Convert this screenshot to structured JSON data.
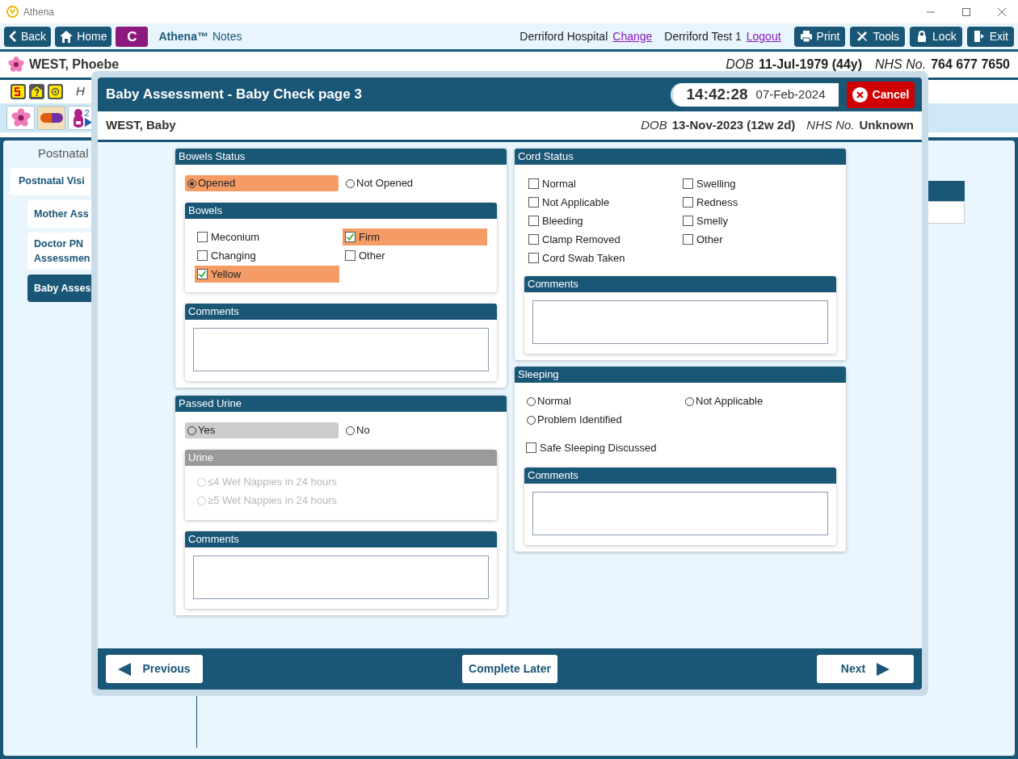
{
  "app": {
    "title": "Athena"
  },
  "toolbar": {
    "nav_buttons": [
      {
        "kind": "back",
        "label": "Back"
      },
      {
        "kind": "home",
        "label": "Home"
      }
    ],
    "c_button": "C",
    "brand": "Athena™",
    "brand_suffix": "Notes",
    "hospital": "Derriford Hospital",
    "change_link": "Change",
    "user": "Derriford Test 1",
    "logout_link": "Logout",
    "actions": [
      {
        "kind": "print",
        "label": "Print"
      },
      {
        "kind": "tools",
        "label": "Tools"
      },
      {
        "kind": "lock",
        "label": "Lock"
      },
      {
        "kind": "exit",
        "label": "Exit"
      }
    ]
  },
  "patient": {
    "name": "WEST, Phoebe",
    "dob_label": "DOB",
    "dob": "11-Jul-1979 (44y)",
    "nhs_label": "NHS No.",
    "nhs": "764 677 7650"
  },
  "alert_row": {
    "text": "H"
  },
  "icon_tabs": [
    {
      "kind": "flower",
      "selected": false
    },
    {
      "kind": "pill",
      "selected": true
    },
    {
      "kind": "person",
      "badge": "2",
      "selected": false
    }
  ],
  "nav": {
    "heading": "Postnatal",
    "items": [
      {
        "label": "Postnatal Visi",
        "selected": false,
        "children": [
          {
            "label": "Mother Ass",
            "selected": false
          },
          {
            "label": "Doctor PN Assessmen",
            "selected": false
          },
          {
            "label": "Baby Asses",
            "selected": true
          }
        ]
      }
    ]
  },
  "dialog": {
    "title": "Baby Assessment - Baby Check page 3",
    "time": "14:42:28",
    "date": "07-Feb-2024",
    "cancel": "Cancel",
    "baby": {
      "name": "WEST, Baby",
      "dob_label": "DOB",
      "dob": "13-Nov-2023 (12w 2d)",
      "nhs_label": "NHS No.",
      "nhs": "Unknown"
    },
    "left": [
      {
        "title": "Bowels Status",
        "radios": [
          {
            "label": "Opened",
            "selected": true,
            "highlighted": true
          },
          {
            "label": "Not Opened",
            "selected": false,
            "highlighted": false
          }
        ],
        "sub": [
          {
            "kind": "checks",
            "title": "Bowels",
            "disabled": false,
            "options": [
              {
                "label": "Meconium",
                "checked": false
              },
              {
                "label": "Firm",
                "checked": true
              },
              {
                "label": "Changing",
                "checked": false
              },
              {
                "label": "Other",
                "checked": false
              },
              {
                "label": "Yellow",
                "checked": true
              }
            ]
          },
          {
            "kind": "comments",
            "title": "Comments"
          }
        ]
      },
      {
        "title": "Passed Urine",
        "radios": [
          {
            "label": "Yes",
            "selected": false,
            "highlighted": true
          },
          {
            "label": "No",
            "selected": false,
            "highlighted": false
          }
        ],
        "sub": [
          {
            "kind": "radios",
            "title": "Urine",
            "disabled": true,
            "options": [
              {
                "label": "≤4 Wet Nappies in 24 hours",
                "selected": false
              },
              {
                "label": "≥5 Wet Nappies in 24 hours",
                "selected": false
              }
            ]
          },
          {
            "kind": "comments",
            "title": "Comments"
          }
        ]
      }
    ],
    "right": [
      {
        "title": "Cord Status",
        "columns": [
          [
            {
              "label": "Normal",
              "checked": false
            },
            {
              "label": "Not Applicable",
              "checked": false
            },
            {
              "label": "Bleeding",
              "checked": false
            },
            {
              "label": "Clamp Removed",
              "checked": false
            },
            {
              "label": "Cord Swab Taken",
              "checked": false
            }
          ],
          [
            {
              "label": "Swelling",
              "checked": false
            },
            {
              "label": "Redness",
              "checked": false
            },
            {
              "label": "Smelly",
              "checked": false
            },
            {
              "label": "Other",
              "checked": false
            }
          ]
        ],
        "sub": [
          {
            "kind": "comments",
            "title": "Comments"
          }
        ]
      },
      {
        "title": "Sleeping",
        "radios": [
          {
            "label": "Normal",
            "selected": false,
            "highlighted": false
          },
          {
            "label": "Not Applicable",
            "selected": false,
            "highlighted": false
          },
          {
            "label": "Problem Identified",
            "selected": false,
            "highlighted": false
          }
        ],
        "extra_check": {
          "label": "Safe Sleeping Discussed",
          "checked": false
        },
        "sub": [
          {
            "kind": "comments",
            "title": "Comments"
          }
        ]
      }
    ],
    "footer": {
      "previous": "Previous",
      "complete_later": "Complete Later",
      "next": "Next"
    }
  }
}
